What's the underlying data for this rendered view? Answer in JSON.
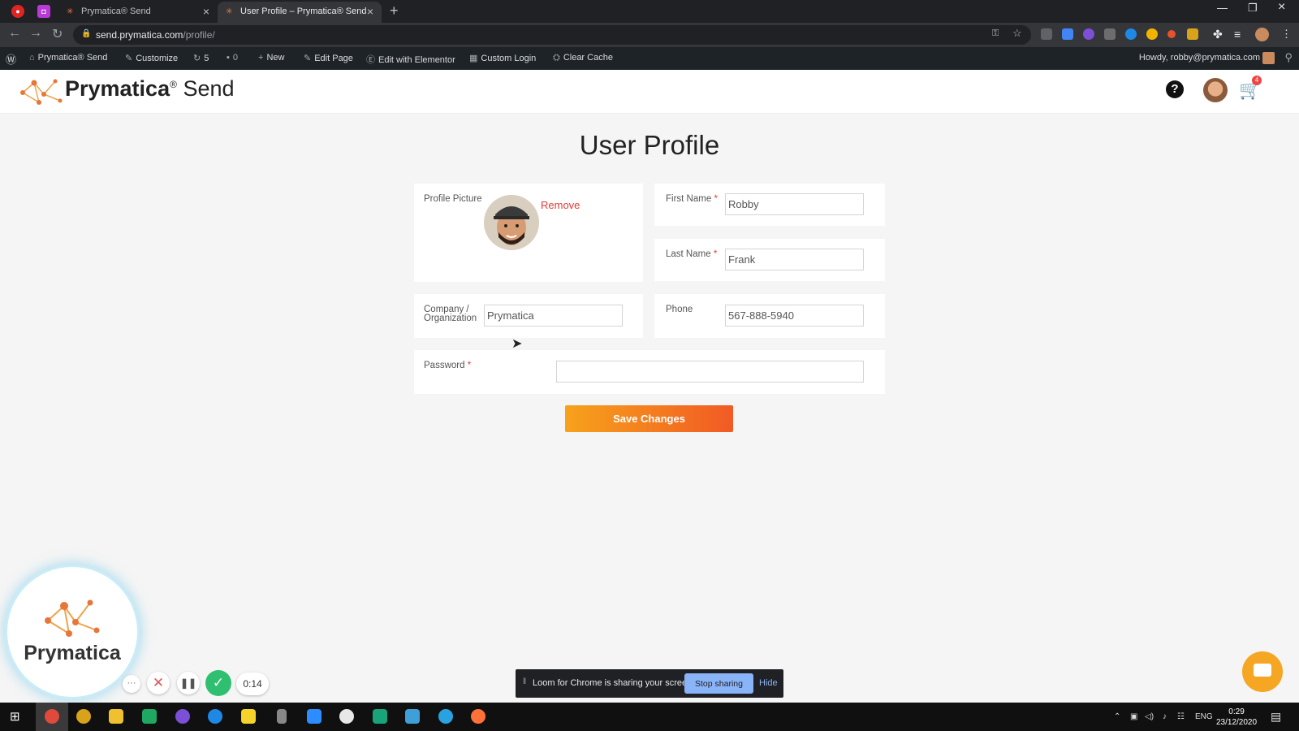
{
  "browser": {
    "tabs": [
      {
        "title": "Prymatica® Send"
      },
      {
        "title": "User Profile – Prymatica® Send"
      }
    ],
    "url_host": "send.prymatica.com",
    "url_path": "/profile/"
  },
  "wp_admin_bar": {
    "site_name": "Prymatica® Send",
    "customize": "Customize",
    "updates_count": "5",
    "comments_count": "0",
    "new": "New",
    "edit_page": "Edit Page",
    "edit_with_elementor": "Edit with Elementor",
    "custom_login": "Custom Login",
    "clear_cache": "Clear Cache",
    "howdy": "Howdy, robby@prymatica.com"
  },
  "site_header": {
    "brand_name": "Prymatica",
    "brand_reg": "®",
    "brand_suffix": "Send",
    "cart_count": "4"
  },
  "page": {
    "title": "User Profile",
    "required_mark": "*",
    "profile_picture_label": "Profile Picture",
    "remove_label": "Remove",
    "first_name_label": "First Name",
    "first_name_value": "Robby",
    "last_name_label": "Last Name",
    "last_name_value": "Frank",
    "company_label_line1": "Company /",
    "company_label_line2": "Organization",
    "company_value": "Prymatica",
    "phone_label": "Phone",
    "phone_value": "567-888-5940",
    "password_label": "Password",
    "password_value": "",
    "save_button": "Save Changes"
  },
  "loom": {
    "bubble_text": "Prymatica",
    "timer": "0:14",
    "sharing_text": "Loom for Chrome is sharing your screen.",
    "stop_sharing": "Stop sharing",
    "hide": "Hide"
  },
  "taskbar": {
    "lang": "ENG",
    "time": "0:29",
    "date": "23/12/2020"
  },
  "colors": {
    "accent_orange": "#f7a21b",
    "accent_red": "#f15a24",
    "required_red": "#e53935"
  }
}
